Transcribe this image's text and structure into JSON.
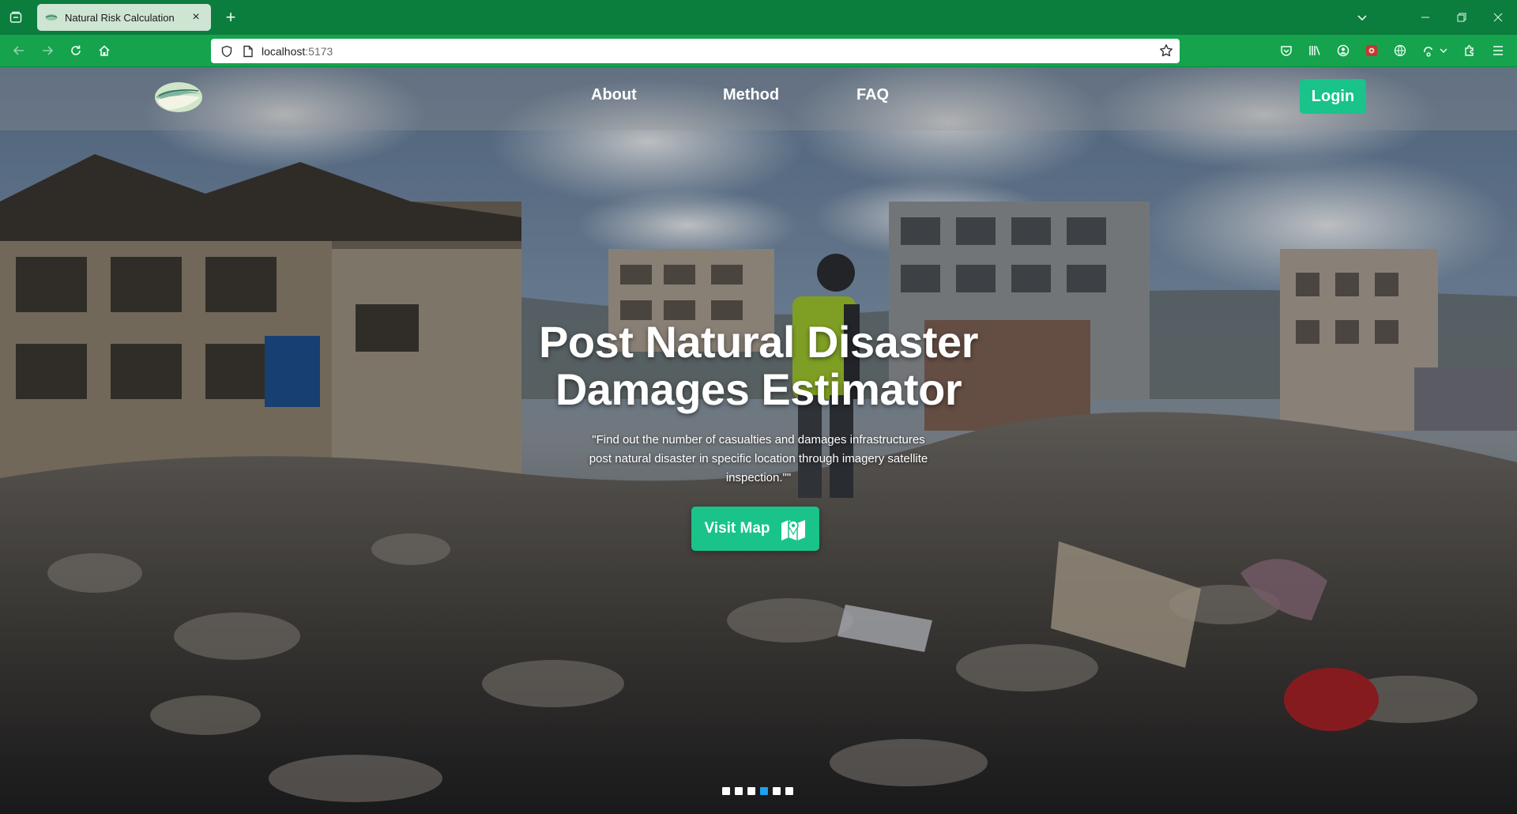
{
  "browser": {
    "tab_title": "Natural Risk Calculation",
    "tab_close": "×",
    "new_tab": "+",
    "url_host": "localhost",
    "url_port": ":5173"
  },
  "header": {
    "menu": [
      "About",
      "Method",
      "FAQ"
    ],
    "login_label": "Login"
  },
  "hero": {
    "title_line1": "Post Natural Disaster",
    "title_line2": "Damages Estimator",
    "subtitle": "\"Find out the number of casualties and damages infrastructures post natural disaster in specific location through imagery satellite inspection.\"\"",
    "cta_label": "Visit Map",
    "cta_icon": "map-marker-icon"
  },
  "carousel": {
    "slide_count": 6,
    "active_index": 3
  },
  "colors": {
    "browser_tabbar": "#0b7d3c",
    "browser_navbar": "#15a34d",
    "accent": "#19c38a",
    "carousel_active": "#1da1f2"
  }
}
